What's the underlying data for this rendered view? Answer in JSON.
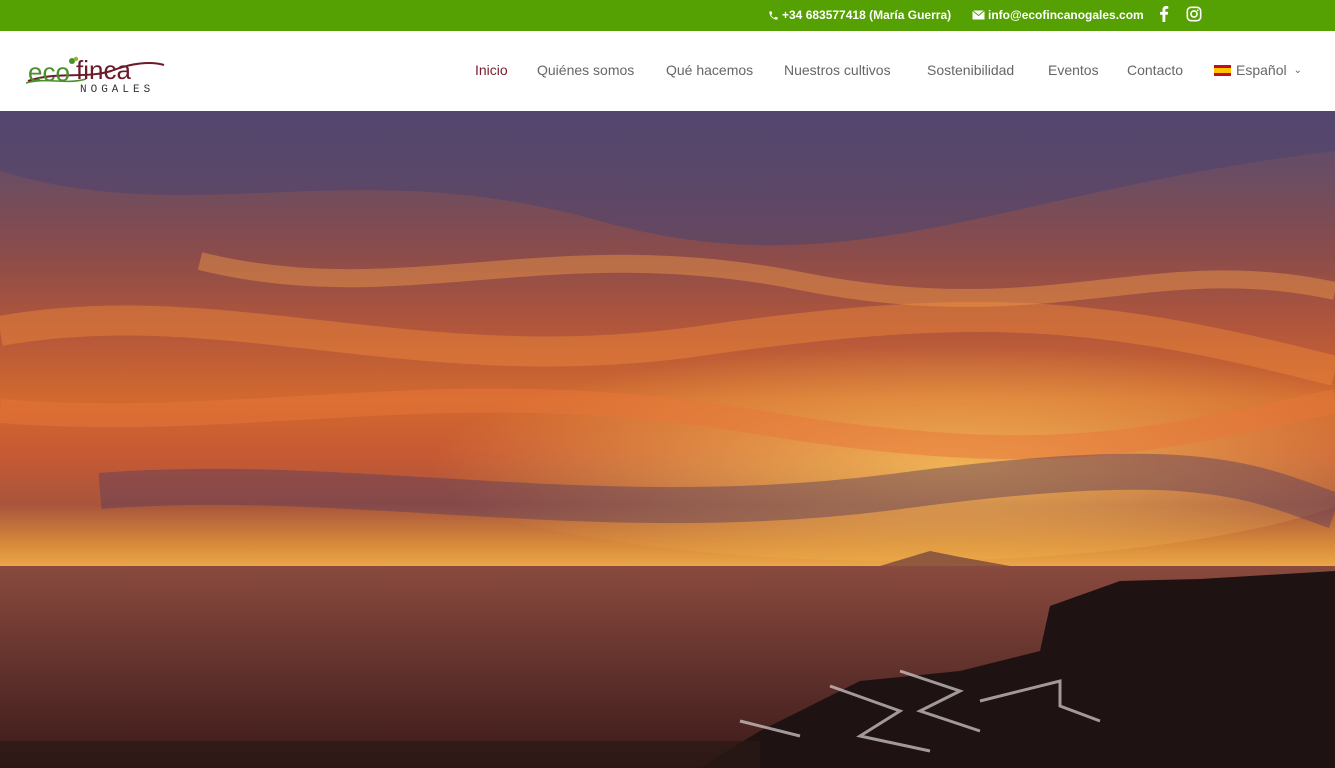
{
  "topbar": {
    "phone": "+34 683577418 (María Guerra)",
    "email": "info@ecofincanogales.com",
    "icons": [
      "phone-icon",
      "mail-icon",
      "facebook-icon",
      "instagram-icon"
    ],
    "bg_color": "#55a003"
  },
  "logo": {
    "text_main": "ecofinca",
    "text_sub": "NOGALES",
    "colors": {
      "eco": "#4a8f2a",
      "finca": "#6b1b2a"
    }
  },
  "nav": {
    "items": [
      {
        "label": "Inicio",
        "active": true
      },
      {
        "label": "Quiénes somos"
      },
      {
        "label": "Qué hacemos"
      },
      {
        "label": "Nuestros cultivos"
      },
      {
        "label": "Sostenibilidad"
      },
      {
        "label": "Eventos"
      },
      {
        "label": "Contacto"
      }
    ],
    "language": {
      "label": "Español",
      "icon": "spain-flag-icon"
    },
    "active_color": "#7a1c2e"
  },
  "hero": {
    "image": "sunset-over-ocean-photo"
  }
}
